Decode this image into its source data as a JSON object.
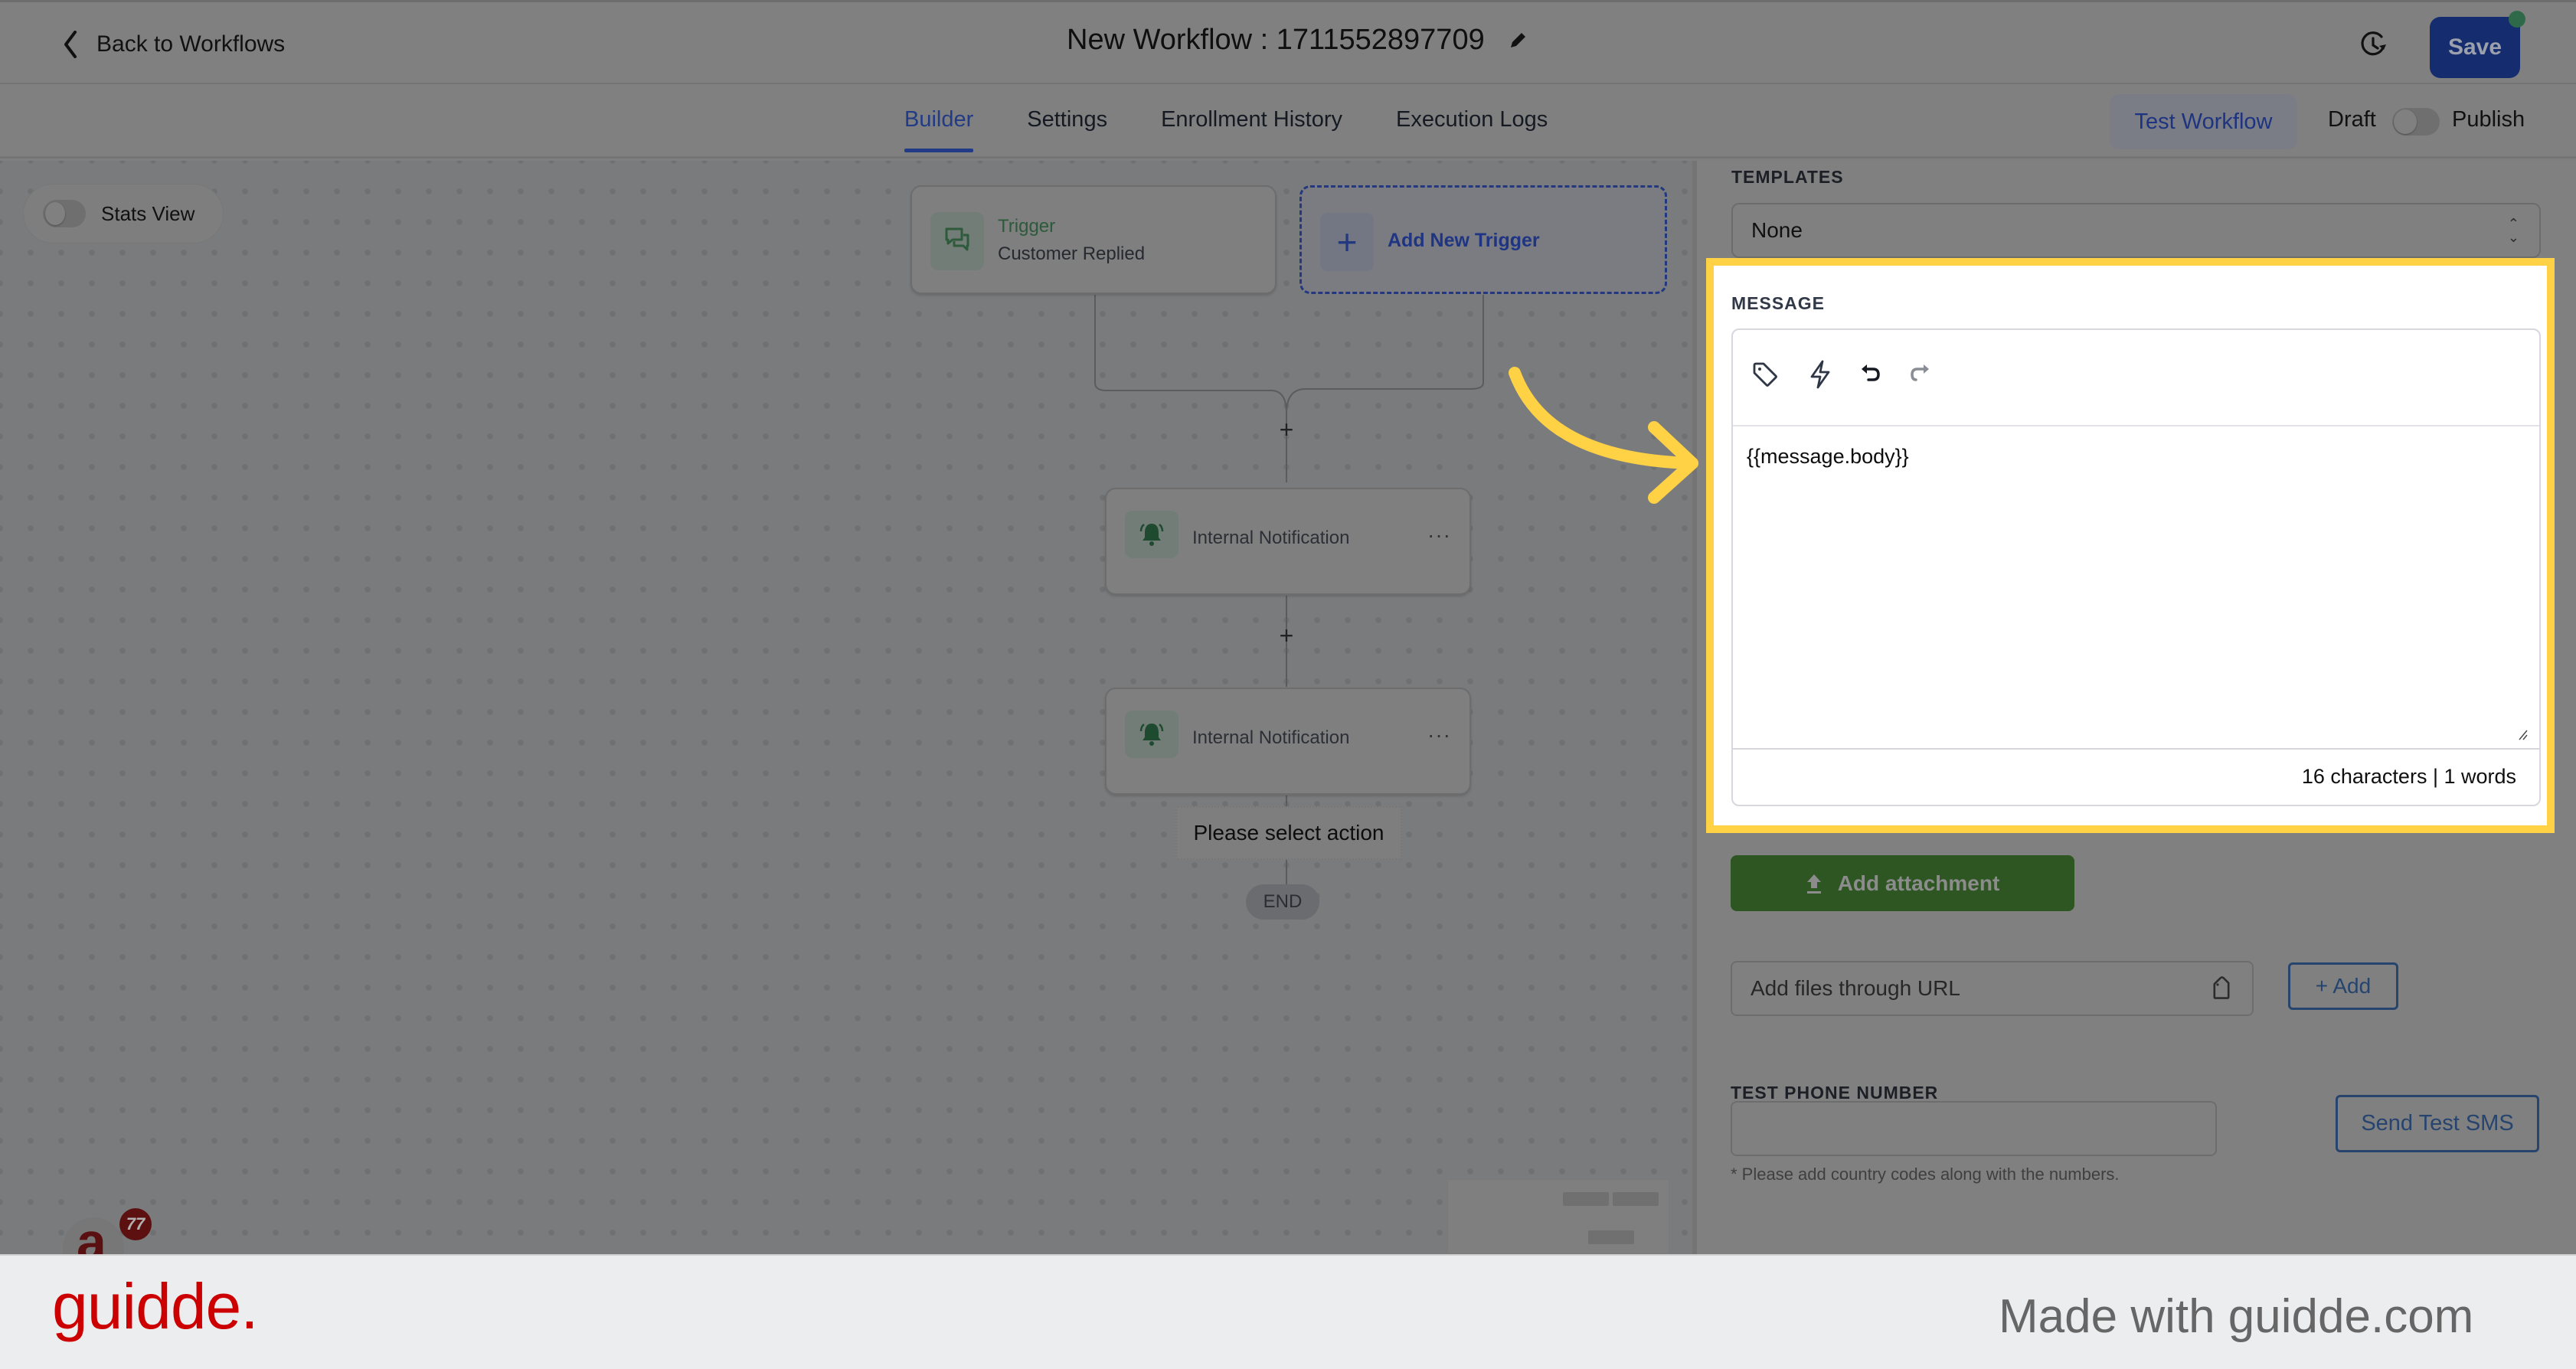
{
  "header": {
    "back_label": "Back to Workflows",
    "title": "New Workflow : 1711552897709",
    "save_label": "Save"
  },
  "tabs": [
    {
      "label": "Builder",
      "active": true
    },
    {
      "label": "Settings",
      "active": false
    },
    {
      "label": "Enrollment History",
      "active": false
    },
    {
      "label": "Execution Logs",
      "active": false
    }
  ],
  "toolbar": {
    "test_workflow_label": "Test Workflow",
    "draft_label": "Draft",
    "publish_label": "Publish",
    "publish_on": false
  },
  "canvas": {
    "stats_view_label": "Stats View",
    "stats_view_on": false,
    "trigger": {
      "title": "Trigger",
      "subtitle": "Customer Replied"
    },
    "add_trigger_label": "Add New Trigger",
    "actions": [
      {
        "label": "Internal Notification"
      },
      {
        "label": "Internal Notification"
      }
    ],
    "more_label": "···",
    "plus_label": "+",
    "select_action_label": "Please select action",
    "end_label": "END",
    "avatar_letter": "a",
    "notification_count": "77"
  },
  "panel": {
    "templates_label": "TEMPLATES",
    "template_value": "None",
    "message_label": "MESSAGE",
    "message_text": "{{message.body}}",
    "counter": "16 characters | 1 words",
    "attach_label": "Add attachment",
    "url_placeholder": "Add files through URL",
    "add_label": "+ Add",
    "test_phone_label": "TEST PHONE NUMBER",
    "test_phone_value": "",
    "phone_note": "* Please add country codes along with the numbers.",
    "send_sms_label": "Send Test SMS"
  },
  "footer": {
    "brand": "guidde.",
    "made_with": "Made with guidde.com"
  },
  "colors": {
    "highlight": "#ffd145",
    "primary": "#152c6e",
    "attach_green": "#2d5622",
    "brand_red": "#cc0000"
  }
}
